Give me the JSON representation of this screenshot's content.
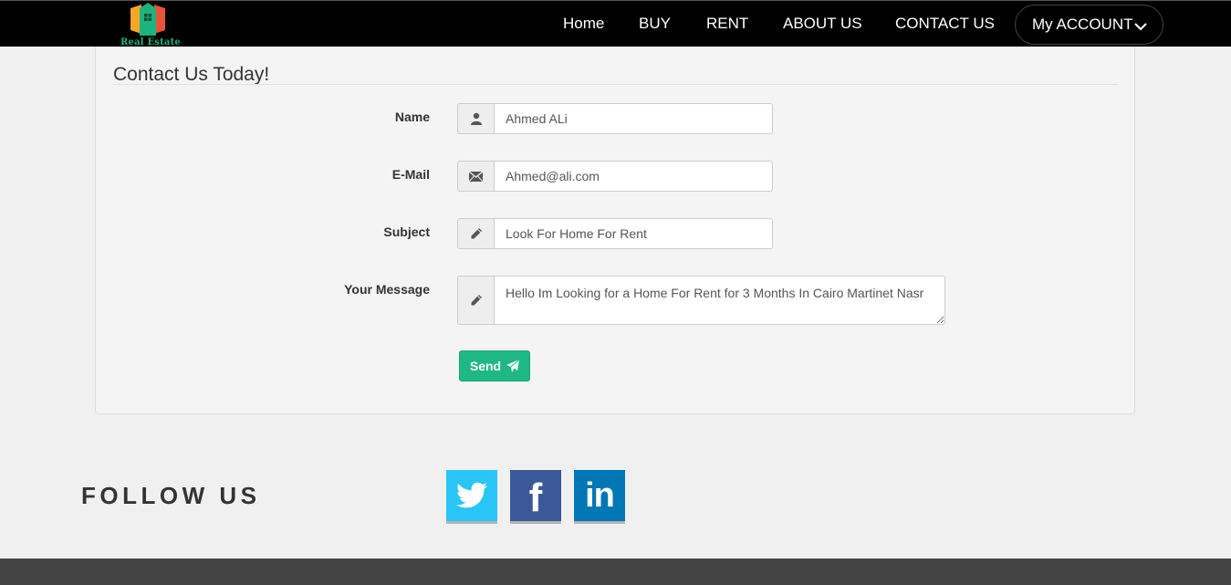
{
  "brand": {
    "name": "Real Estate",
    "colors": {
      "orange": "#f5a623",
      "red": "#e8533a",
      "green": "#1db37f"
    }
  },
  "nav": {
    "items": [
      "Home",
      "BUY",
      "RENT",
      "ABOUT US",
      "CONTACT US"
    ],
    "account_label": "My ACCOUNT",
    "account_icon": "chevron-down-icon"
  },
  "form": {
    "title": "Contact Us Today!",
    "fields": [
      {
        "label": "Name",
        "value": "Ahmed ALi",
        "icon": "user-icon"
      },
      {
        "label": "E-Mail",
        "value": "Ahmed@ali.com",
        "icon": "envelope-icon"
      },
      {
        "label": "Subject",
        "value": "Look For Home For Rent",
        "icon": "pencil-icon"
      },
      {
        "label": "Your Message",
        "value": "Hello Im Looking for a Home For Rent for 3 Months In Cairo Martinet Nasr",
        "icon": "pencil-icon"
      }
    ],
    "send_label": "Send",
    "send_icon": "send-icon",
    "accent": "#1eb884"
  },
  "follow": {
    "label": "FOLLOW US",
    "networks": [
      {
        "name": "twitter",
        "icon": "twitter-icon",
        "color": "#29c5f6"
      },
      {
        "name": "facebook",
        "icon": "facebook-icon",
        "glyph": "f",
        "color": "#3b5998"
      },
      {
        "name": "linkedin",
        "icon": "linkedin-icon",
        "glyph": "in",
        "color": "#0077b5"
      }
    ]
  }
}
